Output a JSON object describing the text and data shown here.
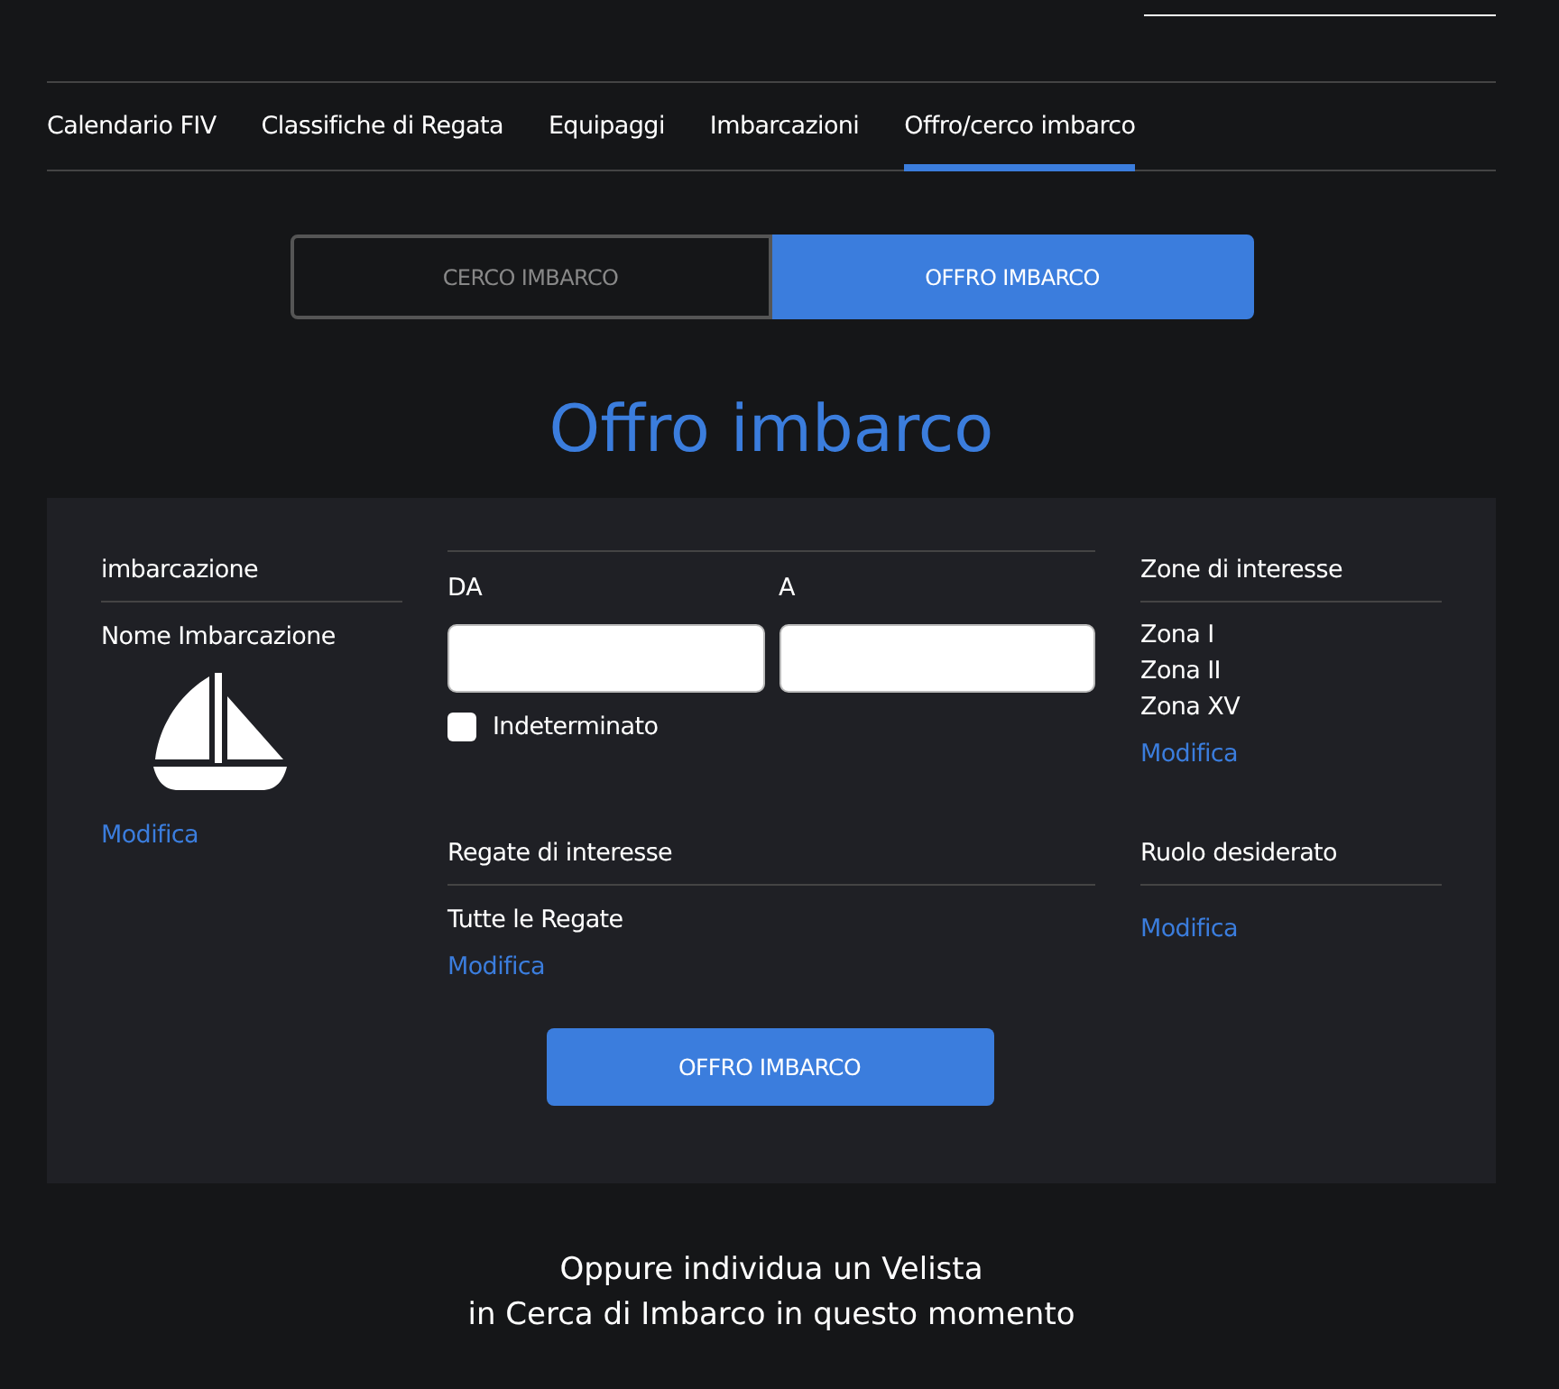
{
  "nav": {
    "tabs": [
      {
        "label": "Calendario FIV",
        "selected": false
      },
      {
        "label": "Classifiche di Regata",
        "selected": false
      },
      {
        "label": "Equipaggi",
        "selected": false
      },
      {
        "label": "Imbarcazioni",
        "selected": false
      },
      {
        "label": "Offro/cerco imbarco",
        "selected": true
      }
    ]
  },
  "toggle": [
    {
      "label": "CERCO IMBARCO",
      "selected": false
    },
    {
      "label": "OFFRO IMBARCO",
      "selected": true
    }
  ],
  "title": "Offro imbarco",
  "form": {
    "boat": {
      "heading": "imbarcazione",
      "name": "Nome Imbarcazione",
      "link": "Modifica"
    },
    "dates": {
      "from_label": "DA",
      "to_label": "A",
      "undetermined": {
        "label": "Indeterminato",
        "checked": false
      }
    },
    "regattas": {
      "heading": "Regate di interesse",
      "items": [
        "Tutte le Regate"
      ],
      "link": "Modifica"
    },
    "zones": {
      "heading": "Zone di interesse",
      "items": [
        "Zona I",
        "Zona II",
        "Zona XV"
      ],
      "link": "Modifica"
    },
    "role": {
      "heading": "Ruolo desiderato",
      "link": "Modifica"
    },
    "submit": "OFFRO IMBARCO"
  },
  "footer_lines": [
    "Oppure individua un Velista",
    "in Cerca di Imbarco in questo momento"
  ]
}
